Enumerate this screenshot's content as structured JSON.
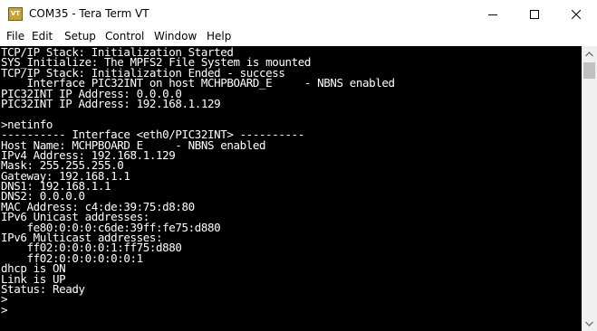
{
  "window": {
    "title": "COM35 - Tera Term VT",
    "icon_label": "VT",
    "controls": [
      "minimize-icon",
      "maximize-icon",
      "close-icon"
    ]
  },
  "menu": [
    "File",
    "Edit",
    "Setup",
    "Control",
    "Window",
    "Help"
  ],
  "terminal": {
    "background": "#000000",
    "foreground": "#ffffff",
    "lines": [
      "TCP/IP Stack: Initialization Started",
      "SYS_Initialize: The MPFS2 File System is mounted",
      "TCP/IP Stack: Initialization Ended - success",
      "    Interface PIC32INT on host MCHPBOARD_E     - NBNS enabled",
      "PIC32INT IP Address: 0.0.0.0",
      "PIC32INT IP Address: 192.168.1.129",
      "",
      ">netinfo",
      "---------- Interface <eth0/PIC32INT> ----------",
      "Host Name: MCHPBOARD_E     - NBNS enabled",
      "IPv4 Address: 192.168.1.129",
      "Mask: 255.255.255.0",
      "Gateway: 192.168.1.1",
      "DNS1: 192.168.1.1",
      "DNS2: 0.0.0.0",
      "MAC Address: c4:de:39:75:d8:80",
      "IPv6 Unicast addresses:",
      "    fe80:0:0:0:c6de:39ff:fe75:d880",
      "IPv6 Multicast addresses:",
      "    ff02:0:0:0:0:1:ff75:d880",
      "    ff02:0:0:0:0:0:0:1",
      "dhcp is ON",
      "Link is UP",
      "Status: Ready",
      ">",
      ">"
    ]
  }
}
